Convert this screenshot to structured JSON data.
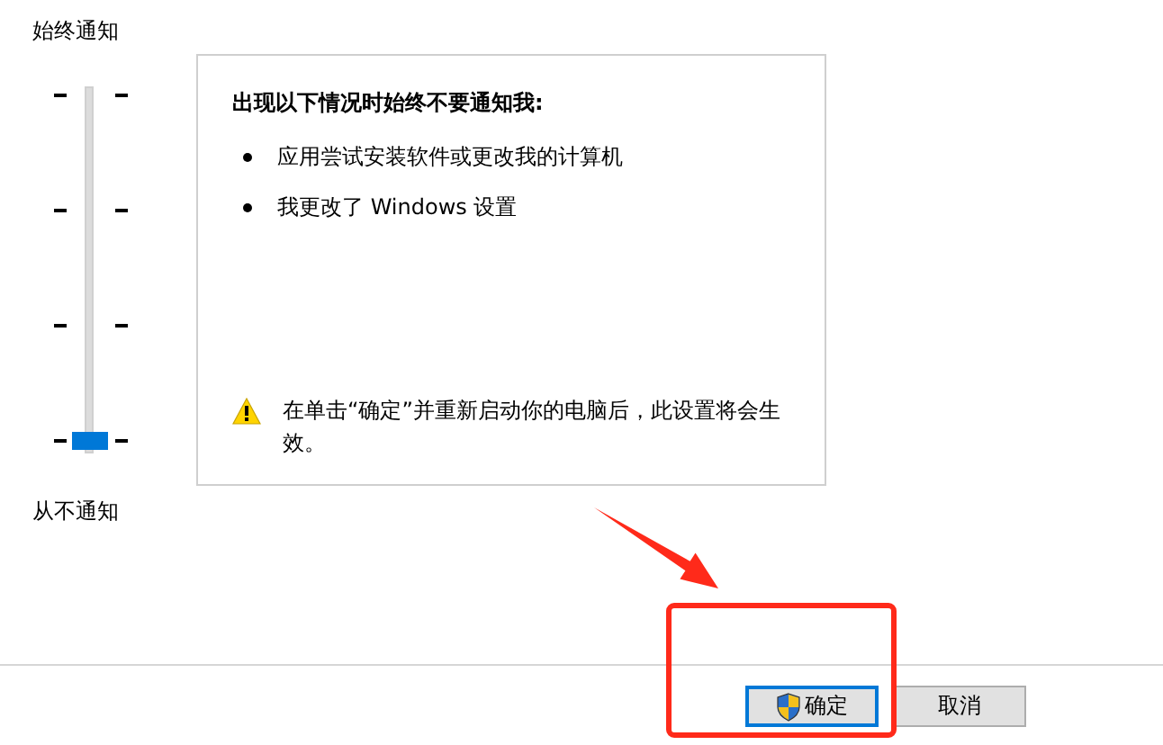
{
  "slider": {
    "top_label": "始终通知",
    "bottom_label": "从不通知",
    "level": 0
  },
  "panel": {
    "heading": "出现以下情况时始终不要通知我:",
    "bullets": [
      "应用尝试安装软件或更改我的计算机",
      "我更改了 Windows 设置"
    ],
    "note": "在单击“确定”并重新启动你的电脑后，此设置将会生效。"
  },
  "buttons": [
    {
      "label": "确定",
      "kind": "shield",
      "focused": true
    },
    {
      "label": "取消",
      "kind": "plain",
      "focused": false
    }
  ],
  "annotations": [
    {
      "kind": "arrow"
    },
    {
      "kind": "box"
    }
  ]
}
